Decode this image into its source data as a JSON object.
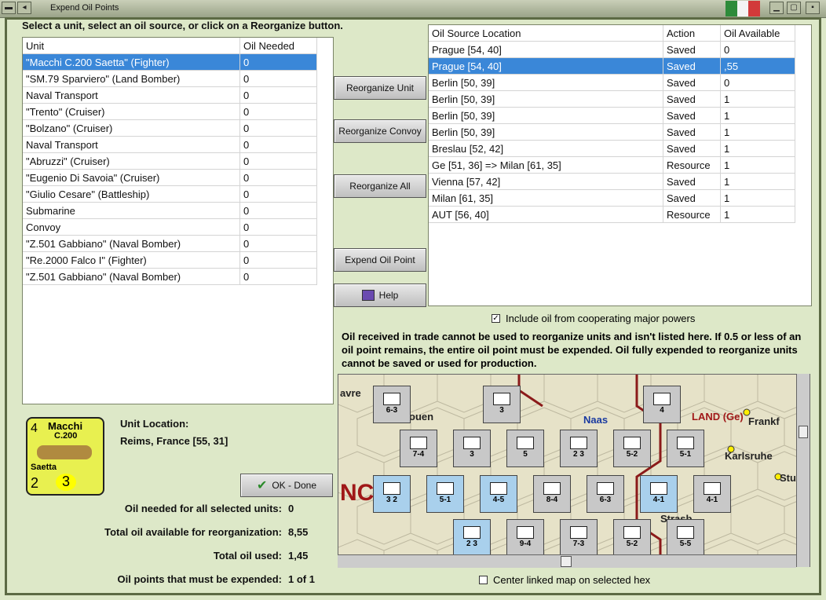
{
  "window": {
    "title": "Expend Oil Points"
  },
  "instructions": "Select a unit, select an oil source, or click on a Reorganize button.",
  "units_table": {
    "headers": [
      "Unit",
      "Oil Needed"
    ],
    "rows": [
      [
        "\"Macchi C.200 Saetta\" (Fighter)",
        "0"
      ],
      [
        "\"SM.79 Sparviero\" (Land Bomber)",
        "0"
      ],
      [
        "Naval Transport",
        "0"
      ],
      [
        "\"Trento\" (Cruiser)",
        "0"
      ],
      [
        "\"Bolzano\" (Cruiser)",
        "0"
      ],
      [
        "Naval Transport",
        "0"
      ],
      [
        "\"Abruzzi\" (Cruiser)",
        "0"
      ],
      [
        "\"Eugenio Di Savoia\" (Cruiser)",
        "0"
      ],
      [
        "\"Giulio Cesare\" (Battleship)",
        "0"
      ],
      [
        "Submarine",
        "0"
      ],
      [
        "Convoy",
        "0"
      ],
      [
        "\"Z.501 Gabbiano\" (Naval Bomber)",
        "0"
      ],
      [
        "\"Re.2000 Falco I\" (Fighter)",
        "0"
      ],
      [
        "\"Z.501 Gabbiano\" (Naval Bomber)",
        "0"
      ]
    ]
  },
  "oil_table": {
    "headers": [
      "Oil Source Location",
      "Action",
      "Oil Available"
    ],
    "rows": [
      [
        "Prague [54, 40]",
        "Saved",
        "0"
      ],
      [
        "Prague [54, 40]",
        "Saved",
        ",55"
      ],
      [
        "Berlin [50, 39]",
        "Saved",
        "0"
      ],
      [
        "Berlin [50, 39]",
        "Saved",
        "1"
      ],
      [
        "Berlin [50, 39]",
        "Saved",
        "1"
      ],
      [
        "Berlin [50, 39]",
        "Saved",
        "1"
      ],
      [
        "Breslau [52, 42]",
        "Saved",
        "1"
      ],
      [
        "Ge [51, 36] => Milan [61, 35]",
        "Resource",
        "1"
      ],
      [
        "Vienna [57, 42]",
        "Saved",
        "1"
      ],
      [
        "Milan [61, 35]",
        "Saved",
        "1"
      ],
      [
        "AUT [56, 40]",
        "Resource",
        "1"
      ]
    ]
  },
  "buttons": {
    "reorganize_unit": "Reorganize Unit",
    "reorganize_convoy": "Reorganize Convoy",
    "reorganize_all": "Reorganize All",
    "expend_oil": "Expend Oil Point",
    "help": "Help",
    "ok_done": "OK - Done"
  },
  "include_oil": "Include oil from cooperating major powers",
  "info_text": "Oil received in trade cannot be used to reorganize units and isn't listed here.  If 0.5 or less of an oil point remains, the entire oil point must be expended.   Oil fully expended to reorganize units cannot be saved or used for production.",
  "unit_card": {
    "name": "Macchi",
    "model": "C.200",
    "nickname": "Saetta",
    "top_left": "4",
    "bottom_left": "2",
    "bottom_mid": "3"
  },
  "unit_location": {
    "label": "Unit Location:",
    "value": "Reims, France [55, 31]"
  },
  "stats": [
    {
      "label": "Oil needed for all selected units:",
      "value": "0"
    },
    {
      "label": "Total oil available for reorganization:",
      "value": "8,55"
    },
    {
      "label": "Total oil used:",
      "value": "1,45"
    },
    {
      "label": "Oil points that must be expended:",
      "value": "1 of 1"
    }
  ],
  "center_map": "Center linked map on selected hex",
  "map_labels": [
    "avre",
    "ouen",
    "Naas",
    "LAND (Ge)",
    "Frankf",
    "Karlsruhe",
    "Stu",
    "NC",
    "Strasb"
  ],
  "colors": {
    "selection": "#3a87d8",
    "background": "#dde8c8",
    "frame": "#5c6a44"
  }
}
